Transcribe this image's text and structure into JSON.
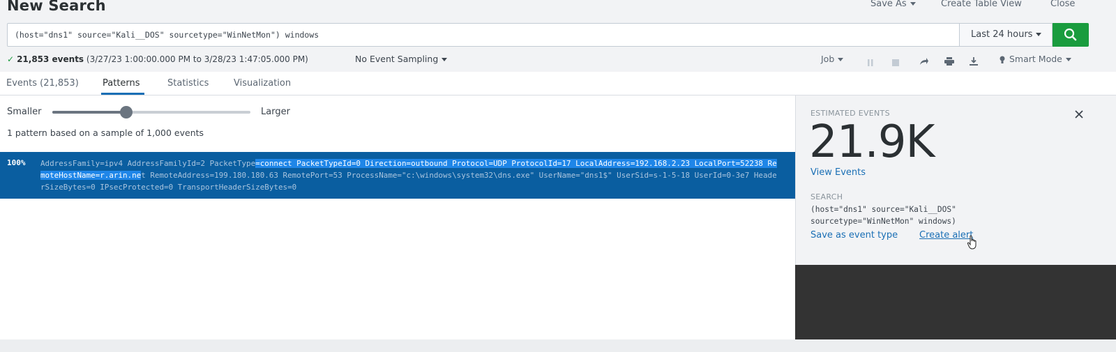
{
  "header": {
    "title": "New Search",
    "save_as": "Save As",
    "create_table_view": "Create Table View",
    "close": "Close"
  },
  "search": {
    "query": "(host=\"dns1\" source=\"Kali__DOS\" sourcetype=\"WinNetMon\") windows",
    "time_range": "Last 24 hours",
    "search_icon": "search-icon"
  },
  "status": {
    "count": "21,853 events",
    "range": "(3/27/23 1:00:00.000 PM to 3/28/23 1:47:05.000 PM)",
    "sampling": "No Event Sampling",
    "job": "Job",
    "mode": "Smart Mode"
  },
  "tabs": {
    "events": "Events (21,853)",
    "patterns": "Patterns",
    "statistics": "Statistics",
    "visualization": "Visualization"
  },
  "patterns": {
    "smaller": "Smaller",
    "larger": "Larger",
    "slider_level_percent": 38,
    "summary": "1 pattern based on a sample of 1,000 events",
    "row": {
      "pct": "100%",
      "text_a": "AddressFamily=ipv4 AddressFamilyId=2 PacketType",
      "text_hl": "=connect PacketTypeId=0 Direction=outbound Protocol=UDP ProtocolId=17 LocalAddress=192.168.2.23 LocalPort=52238 RemoteHostName=r.arin.ne",
      "text_b": "t RemoteAddress=199.180.180.63 RemotePort=53 ProcessName=\"c:\\windows\\system32\\dns.exe\" UserName=\"dns1$\" UserSid=s-1-5-18 UserId=0-3e7 HeaderSizeBytes=0 IPsecProtected=0 TransportHeaderSizeBytes=0"
    }
  },
  "side_panel": {
    "estimated_label": "ESTIMATED EVENTS",
    "estimated_value": "21.9K",
    "view_events": "View Events",
    "search_label": "SEARCH",
    "search_text": "(host=\"dns1\" source=\"Kali__DOS\" sourcetype=\"WinNetMon\" windows)",
    "save_event_type": "Save as event type",
    "create_alert": "Create alert"
  },
  "colors": {
    "accent": "#1a6fb5",
    "search_green": "#1a9c3e",
    "pattern_row": "#0a5ea0",
    "highlight": "#1f86e8"
  }
}
